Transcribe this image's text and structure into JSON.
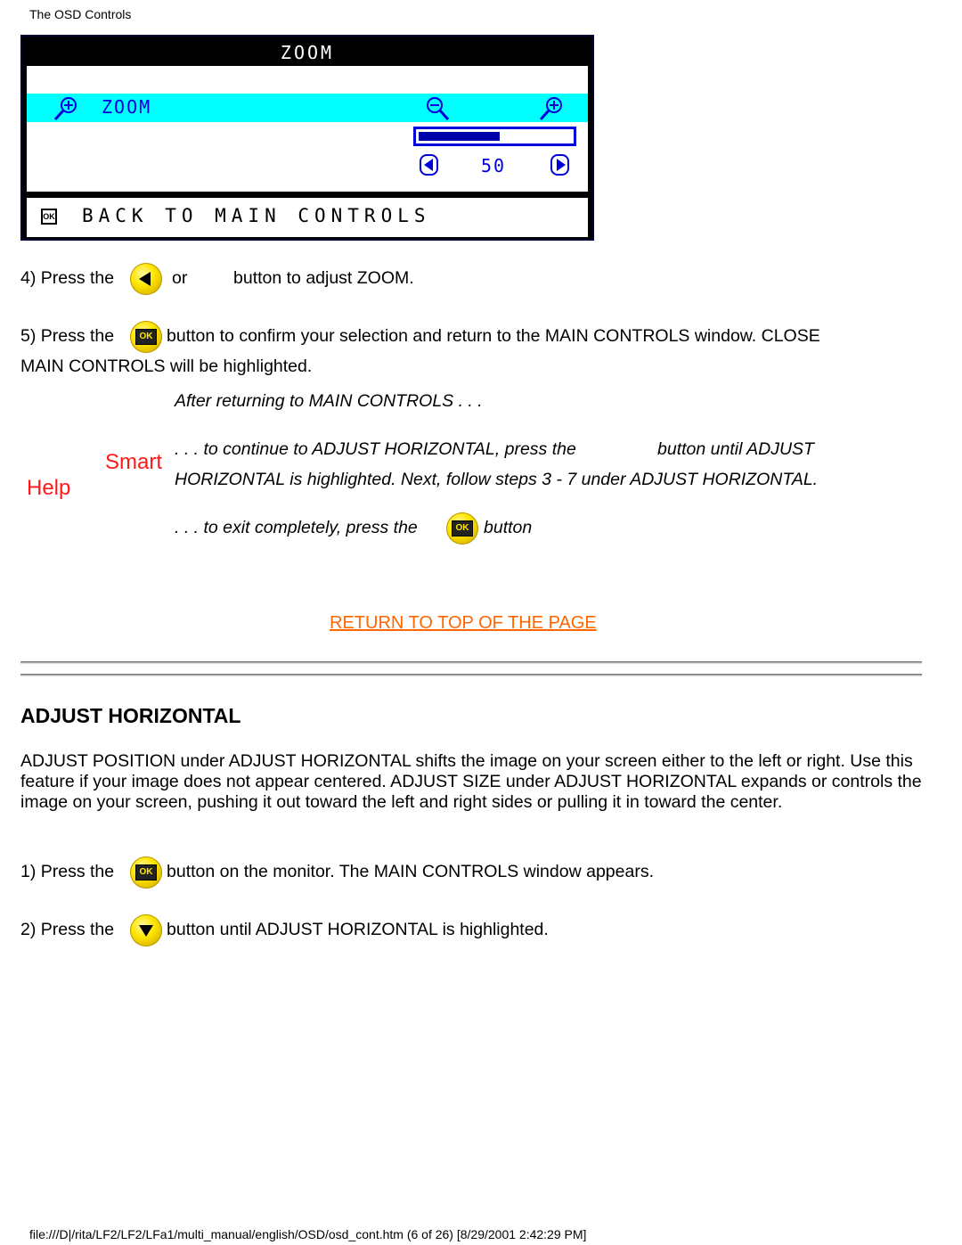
{
  "header": {
    "title": "The OSD Controls"
  },
  "osd": {
    "title": "ZOOM",
    "item_label": "ZOOM",
    "icons": {
      "zoom_in": "zoom-in-icon",
      "zoom_out": "zoom-out-icon",
      "left": "left-arrow-icon",
      "right": "right-arrow-icon",
      "ok": "ok-icon"
    },
    "value": "50",
    "level_percent": 50,
    "back_label": "BACK TO MAIN CONTROLS",
    "ok_glyph": "OK",
    "colors": {
      "highlight": "#00ffff",
      "text": "#0000dd",
      "frame": "#000000"
    }
  },
  "steps_zoom": {
    "step4_a": "4) Press the",
    "step4_b": "or",
    "step4_c": "button to adjust ZOOM.",
    "step5_a": "5) Press the",
    "step5_b": "button to confirm your selection and return to the MAIN CONTROLS window. CLOSE",
    "step5_c": "MAIN CONTROLS will be highlighted."
  },
  "smart_help": {
    "label_smart": "Smart",
    "label_help": "Help",
    "after": "After returning to MAIN CONTROLS . . .",
    "continue_a": ". . . to continue to ADJUST HORIZONTAL, press the",
    "continue_b": "button until ADJUST",
    "continue_c": "HORIZONTAL is highlighted. Next, follow steps 3 - 7 under ADJUST HORIZONTAL.",
    "exit_a": ". . . to exit completely, press the",
    "exit_b": "button",
    "color": "#ff1a1a"
  },
  "link": {
    "return_top": "RETURN TO TOP OF THE PAGE",
    "color": "#ff6600"
  },
  "section": {
    "title": "ADJUST HORIZONTAL",
    "body": "ADJUST POSITION under ADJUST HORIZONTAL shifts the image on your screen either to the left or right. Use this feature if your image does not appear centered. ADJUST SIZE under ADJUST HORIZONTAL expands or controls the image on your screen, pushing it out toward the left and right sides or pulling it in toward the center.",
    "step1_a": "1) Press the",
    "step1_b": "button on the monitor. The MAIN CONTROLS window appears.",
    "step2_a": "2) Press the",
    "step2_b": "button until ADJUST HORIZONTAL is highlighted."
  },
  "footer": {
    "path": "file:///D|/rita/LF2/LF2/LFa1/multi_manual/english/OSD/osd_cont.htm (6 of 26) [8/29/2001 2:42:29 PM]"
  }
}
